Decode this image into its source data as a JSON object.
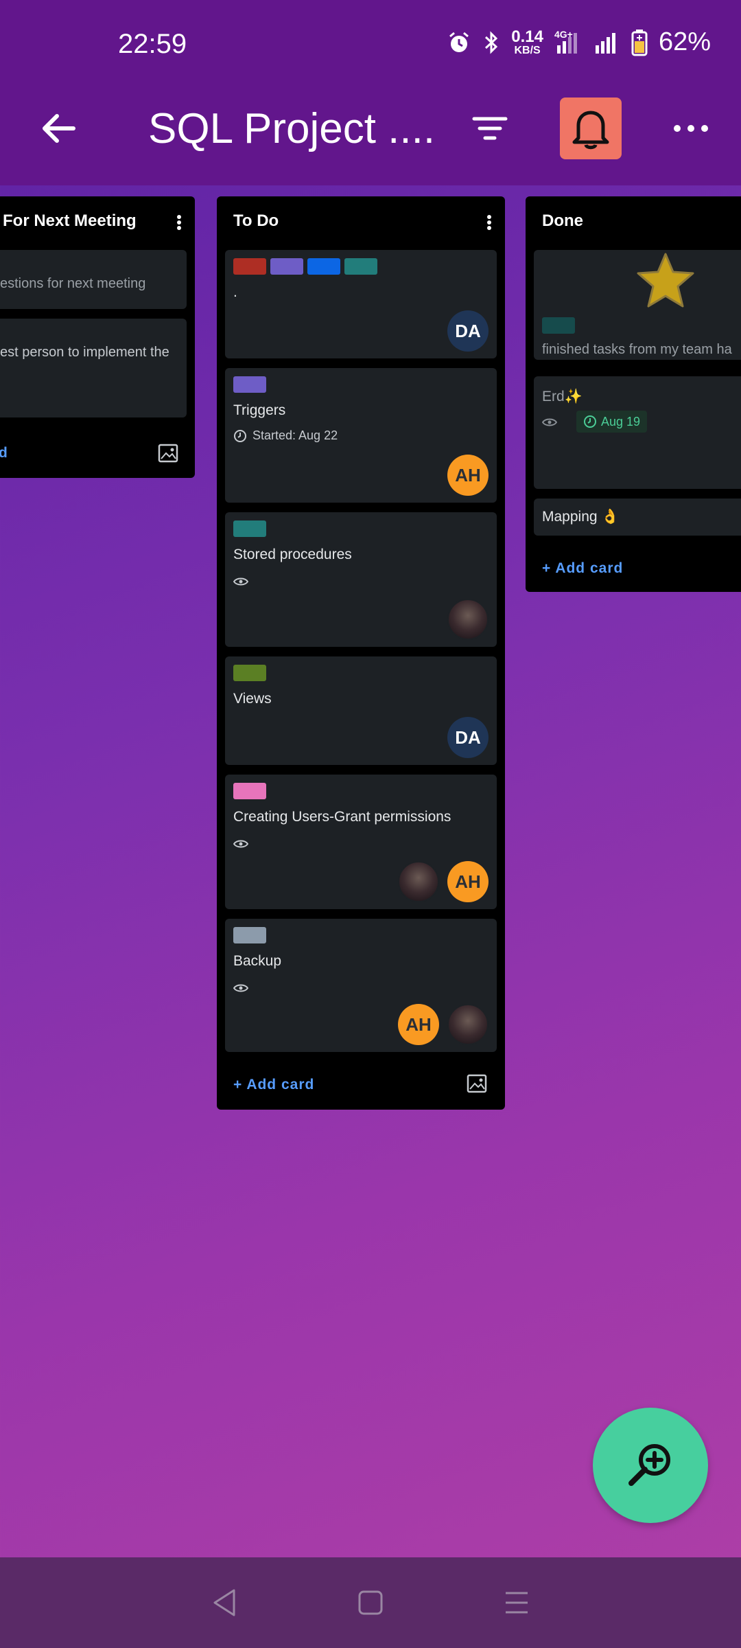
{
  "status_bar": {
    "time": "22:59",
    "net_speed_value": "0.14",
    "net_speed_unit": "KB/S",
    "network_type": "4G+",
    "battery": "62%"
  },
  "app_bar": {
    "title": "SQL Project ....",
    "bell_color": "#f07565"
  },
  "lists": [
    {
      "title": "For Next Meeting",
      "cards": [
        {
          "title": "estions for next meeting"
        },
        {
          "title": "est person to implement the"
        }
      ],
      "add_label": "d"
    },
    {
      "title": "To Do",
      "cards": [
        {
          "labels": [
            "#ae2e24",
            "#6e5dc6",
            "#0c66e4",
            "#227d7b"
          ],
          "title": ".",
          "avatars": [
            "DA"
          ]
        },
        {
          "labels": [
            "#6e5dc6"
          ],
          "title": "Triggers",
          "meta": "Started: Aug 22",
          "avatars": [
            "AH"
          ]
        },
        {
          "labels": [
            "#227d7b"
          ],
          "title": "Stored procedures",
          "avatars": [
            "photo"
          ]
        },
        {
          "labels": [
            "#5b7f24"
          ],
          "title": "Views",
          "avatars": [
            "DA"
          ]
        },
        {
          "labels": [
            "#e774bb"
          ],
          "title": "Creating Users-Grant permissions",
          "avatars": [
            "photo",
            "AH"
          ]
        },
        {
          "labels": [
            "#8c9bab"
          ],
          "title": "Backup",
          "avatars": [
            "AH",
            "photo"
          ]
        }
      ],
      "add_label": "+ Add card"
    },
    {
      "title": "Done",
      "cards": [
        {
          "labels": [
            "#164b4c"
          ],
          "title": "finished tasks from  my team ha"
        },
        {
          "title": "Erd✨",
          "due": "Aug 19"
        },
        {
          "title": "Mapping 👌"
        }
      ],
      "add_label": "+ Add card"
    }
  ],
  "fab": {
    "icon": "zoom-in-icon",
    "color": "#47cf9e"
  },
  "nav": {
    "icons": [
      "back-triangle-icon",
      "home-square-icon",
      "menu-lines-icon"
    ]
  }
}
